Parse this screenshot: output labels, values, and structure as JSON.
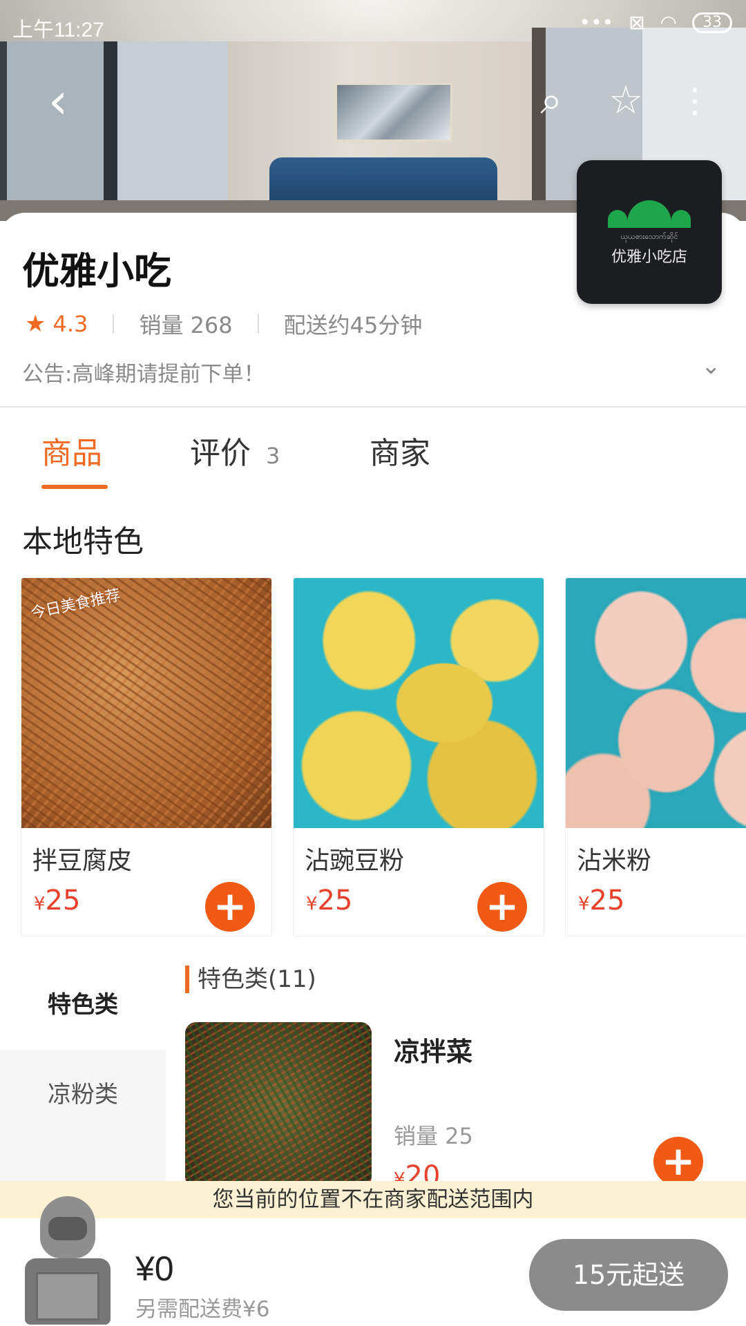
{
  "status_bar": {
    "time": "上午11:27",
    "battery": "33",
    "icons": [
      "more-dots-icon",
      "sim-off-icon",
      "wifi-icon",
      "battery-icon"
    ]
  },
  "header": {
    "back_icon": "‹",
    "search_icon": "⌕",
    "favorite_icon": "☆",
    "more_icon": "⋮"
  },
  "shop": {
    "name": "优雅小吃",
    "rating": "4.3",
    "sales": "销量 268",
    "delivery_time": "配送约45分钟",
    "notice": "公告:高峰期请提前下单！",
    "logo_text": "优雅小吃店",
    "logo_subtext": "ယုယစားသောက်ဆိုင်"
  },
  "tabs": {
    "goods": "商品",
    "reviews": "评价",
    "reviews_count": "3",
    "merchant": "商家"
  },
  "featured": {
    "title": "本地特色",
    "items": [
      {
        "name": "拌豆腐皮",
        "currency": "¥",
        "price": "25",
        "tag": "今日美食推荐"
      },
      {
        "name": "沾豌豆粉",
        "currency": "¥",
        "price": "25"
      },
      {
        "name": "沾米粉",
        "currency": "¥",
        "price": "25"
      }
    ]
  },
  "categories": {
    "active": "特色类",
    "other": "凉粉类"
  },
  "list": {
    "header": "特色类(11)",
    "items": [
      {
        "name": "凉拌菜",
        "sales": "销量 25",
        "currency": "¥",
        "price": "20"
      }
    ]
  },
  "range_notice": "您当前的位置不在商家配送范围内",
  "cart": {
    "total": "¥0",
    "delivery_fee": "另需配送费¥6",
    "checkout": "15元起送"
  },
  "colors": {
    "accent": "#f06a22",
    "price": "#e8412c",
    "add_button": "#f05a14",
    "notice_bg": "#fcf1d2"
  }
}
